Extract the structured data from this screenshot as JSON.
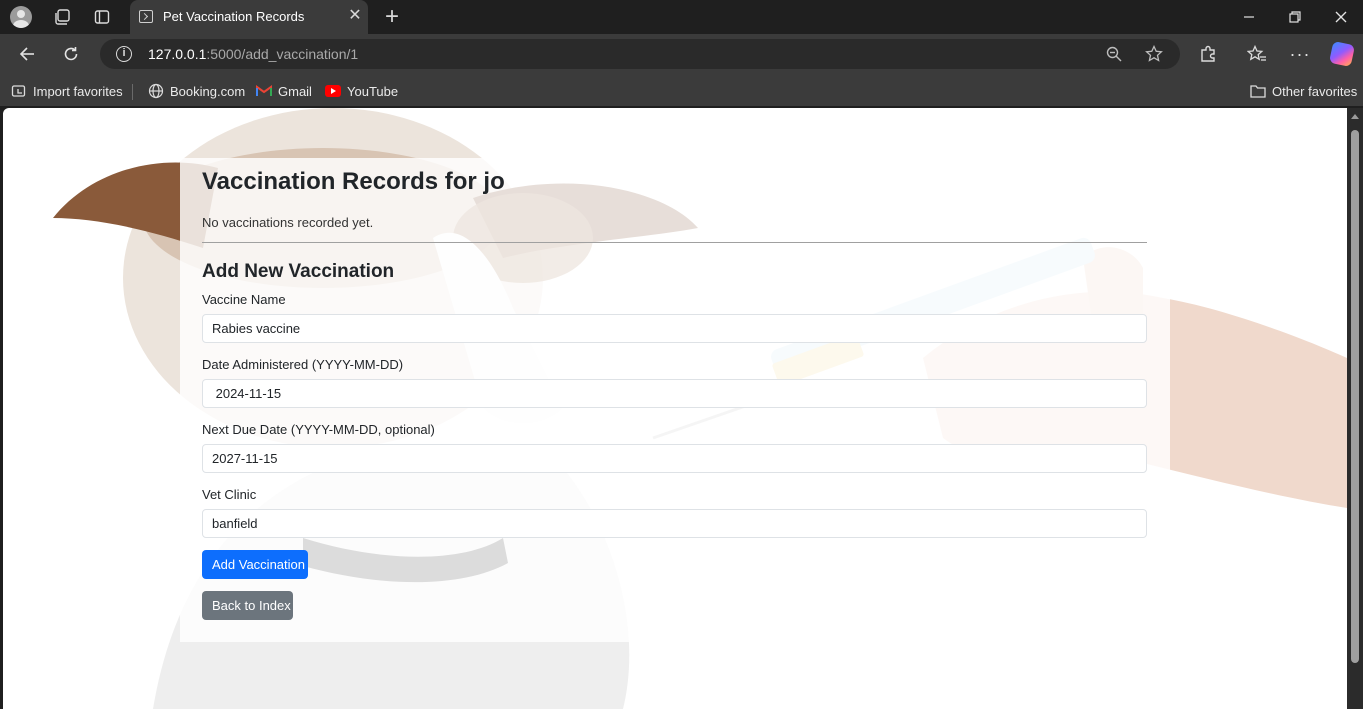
{
  "browser": {
    "tab_title": "Pet Vaccination Records",
    "url_host": "127.0.0.1",
    "url_path": ":5000/add_vaccination/1",
    "bookmarks": [
      {
        "label": "Import favorites",
        "icon": "import-icon"
      },
      {
        "label": "Booking.com",
        "icon": "globe-icon"
      },
      {
        "label": "Gmail",
        "icon": "gmail-icon"
      },
      {
        "label": "YouTube",
        "icon": "youtube-icon"
      }
    ],
    "other_favorites": "Other favorites"
  },
  "page": {
    "title": "Vaccination Records for jo",
    "empty_message": "No vaccinations recorded yet.",
    "form_title": "Add New Vaccination",
    "fields": [
      {
        "label": "Vaccine Name",
        "value": "Rabies vaccine"
      },
      {
        "label": "Date Administered (YYYY-MM-DD)",
        "value": " 2024-11-15"
      },
      {
        "label": "Next Due Date (YYYY-MM-DD, optional)",
        "value": "2027-11-15"
      },
      {
        "label": "Vet Clinic",
        "value": "banfield"
      }
    ],
    "submit_label": "Add Vaccination",
    "back_label": "Back to Index"
  },
  "colors": {
    "primary_button": "#0d6efd",
    "secondary_button": "#6c757d"
  }
}
